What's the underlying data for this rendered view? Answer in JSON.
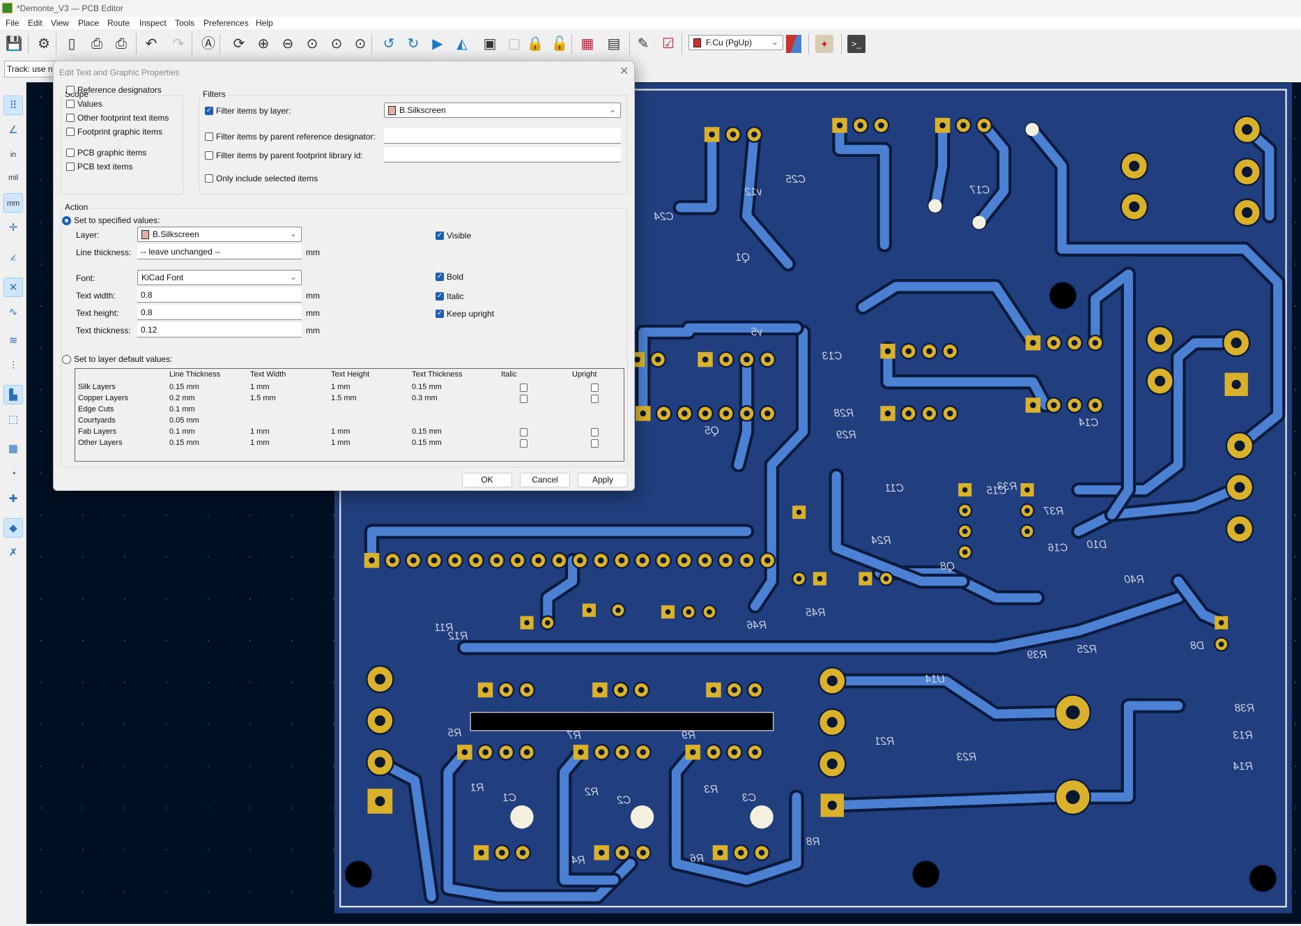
{
  "window": {
    "title": "*Demonte_V3 — PCB Editor"
  },
  "menu": [
    "File",
    "Edit",
    "View",
    "Place",
    "Route",
    "Inspect",
    "Tools",
    "Preferences",
    "Help"
  ],
  "toolbar": {
    "icons": [
      "save-icon",
      "board-setup-icon",
      "page-settings-icon",
      "print-icon",
      "plot-icon",
      "undo-icon",
      "redo-icon",
      "find-icon",
      "refresh-icon",
      "zoom-in-icon",
      "zoom-out-icon",
      "zoom-fit-icon",
      "zoom-objects-icon",
      "zoom-selection-icon",
      "rotate-ccw-icon",
      "rotate-cw-icon",
      "flip-icon",
      "mirror-icon",
      "group-icon",
      "ungroup-icon",
      "lock-icon",
      "unlock-icon",
      "netlist-update-icon",
      "footprint-browser-icon",
      "schematic-icon",
      "drc-icon"
    ],
    "active_layer": "F.Cu (PgUp)",
    "active_layer_color": "#c83232"
  },
  "toolbar2": {
    "track_width": "Track: use net"
  },
  "left_toolbar": [
    "grid-icon",
    "polar-coords-icon",
    "inch-units-icon",
    "mil-units-icon",
    "mm-units-icon",
    "cursor-icon",
    "angle-snap-icon",
    "ratsnest-icon",
    "curved-ratsnest-icon",
    "track-display-icon",
    "via-display-icon",
    "pad-display-icon",
    "footprint-outline-icon",
    "zone-display-icon",
    "text-display-icon",
    "track-clearance-icon",
    "layers-icon",
    "tools-icon"
  ],
  "dialog": {
    "title": "Edit Text and Graphic Properties",
    "scope": {
      "label": "Scope",
      "items": [
        {
          "label": "Reference designators",
          "checked": false
        },
        {
          "label": "Values",
          "checked": false
        },
        {
          "label": "Other footprint text items",
          "checked": false
        },
        {
          "label": "Footprint graphic items",
          "checked": false
        },
        {
          "label": "PCB graphic items",
          "checked": false
        },
        {
          "label": "PCB text items",
          "checked": false
        }
      ]
    },
    "filters": {
      "label": "Filters",
      "by_layer": {
        "label": "Filter items by layer:",
        "checked": true,
        "value": "B.Silkscreen"
      },
      "by_ref": {
        "label": "Filter items by parent reference designator:",
        "checked": false,
        "value": ""
      },
      "by_lib": {
        "label": "Filter items by parent footprint library id:",
        "checked": false,
        "value": ""
      },
      "selected": {
        "label": "Only include selected items",
        "checked": false
      }
    },
    "action": {
      "label": "Action",
      "set_specified": "Set to specified values:",
      "layer_label": "Layer:",
      "layer": "B.Silkscreen",
      "layer_color": "#e3b0a4",
      "line_thickness_label": "Line thickness:",
      "line_thickness": "-- leave unchanged --",
      "font_label": "Font:",
      "font": "KiCad Font",
      "text_width_label": "Text width:",
      "text_width": "0.8",
      "text_height_label": "Text height:",
      "text_height": "0.8",
      "text_thickness_label": "Text thickness:",
      "text_thickness": "0.12",
      "unit": "mm",
      "visible": {
        "label": "Visible",
        "checked": true
      },
      "bold": {
        "label": "Bold",
        "checked": true
      },
      "italic": {
        "label": "Italic",
        "checked": true
      },
      "keep_upright": {
        "label": "Keep upright",
        "checked": true
      },
      "set_default": "Set to layer default values:",
      "selected_option": "set_specified"
    },
    "defaults_table": {
      "headers": [
        "",
        "Line Thickness",
        "Text Width",
        "Text Height",
        "Text Thickness",
        "Italic",
        "Upright"
      ],
      "rows": [
        [
          "Silk Layers",
          "0.15 mm",
          "1 mm",
          "1 mm",
          "0.15 mm",
          false,
          false
        ],
        [
          "Copper Layers",
          "0.2 mm",
          "1.5 mm",
          "1.5 mm",
          "0.3 mm",
          false,
          false
        ],
        [
          "Edge Cuts",
          "0.1 mm",
          "",
          "",
          "",
          null,
          null
        ],
        [
          "Courtyards",
          "0.05 mm",
          "",
          "",
          "",
          null,
          null
        ],
        [
          "Fab Layers",
          "0.1 mm",
          "1 mm",
          "1 mm",
          "0.15 mm",
          false,
          false
        ],
        [
          "Other Layers",
          "0.15 mm",
          "1 mm",
          "1 mm",
          "0.15 mm",
          false,
          false
        ]
      ]
    },
    "buttons": {
      "ok": "OK",
      "cancel": "Cancel",
      "apply": "Apply"
    }
  },
  "pcb": {
    "colors": {
      "background": "#001023",
      "board": "#213f7e",
      "copper": "#4c80d2",
      "pad": "#d9b12c",
      "silk": "#cdd2e4"
    },
    "silk_labels": [
      "R1",
      "R2",
      "R3",
      "C1",
      "C2",
      "C3",
      "R5",
      "R7",
      "R9",
      "R4",
      "R6",
      "R8",
      "R11",
      "R12",
      "R13",
      "R14",
      "R21",
      "R23",
      "R24",
      "R25",
      "R28",
      "R29",
      "R33",
      "R37",
      "R38",
      "R39",
      "R40",
      "R45",
      "R46",
      "Q1",
      "Q5",
      "Q8",
      "C11",
      "C13",
      "C14",
      "C15",
      "C16",
      "C17",
      "C24",
      "C25",
      "D8",
      "D10",
      "U14",
      "v12",
      "v5"
    ]
  }
}
